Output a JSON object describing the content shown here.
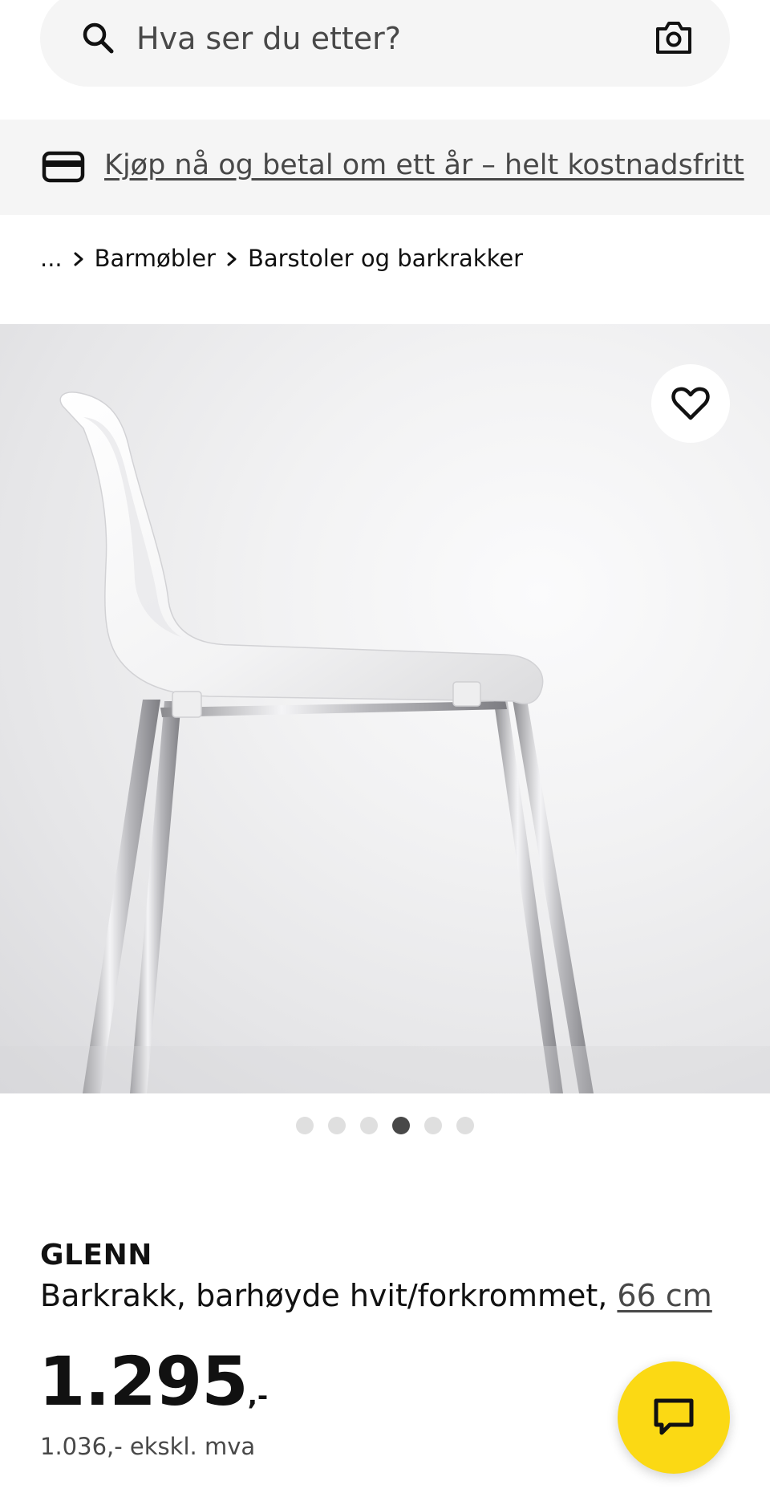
{
  "search": {
    "placeholder": "Hva ser du etter?",
    "leading_icon": "search-icon",
    "trailing_icon": "camera-icon"
  },
  "promo": {
    "icon": "credit-card-icon",
    "text": "Kjøp nå og betal om ett år – helt kostnadsfritt"
  },
  "breadcrumb": {
    "items": [
      "...",
      "Barmøbler",
      "Barstoler og barkrakker"
    ],
    "separator_icon": "chevron-right-icon"
  },
  "gallery": {
    "image_count": 6,
    "active_index": 3,
    "favorite_icon": "heart-outline-icon"
  },
  "product": {
    "name": "GLENN",
    "description": "Barkrakk, barhøyde hvit/forkrommet, ",
    "size_link": "66 cm",
    "price_main": "1.295",
    "price_suffix": ",-",
    "price_ex_vat": "1.036,- ekskl. mva"
  },
  "chat": {
    "icon": "chat-bubble-icon",
    "color": "#fbd914"
  },
  "colors": {
    "surface_gray": "#f5f5f5",
    "text_primary": "#111111",
    "text_secondary": "#484848",
    "dot_inactive": "#dfdfdf",
    "dot_active": "#484848"
  }
}
